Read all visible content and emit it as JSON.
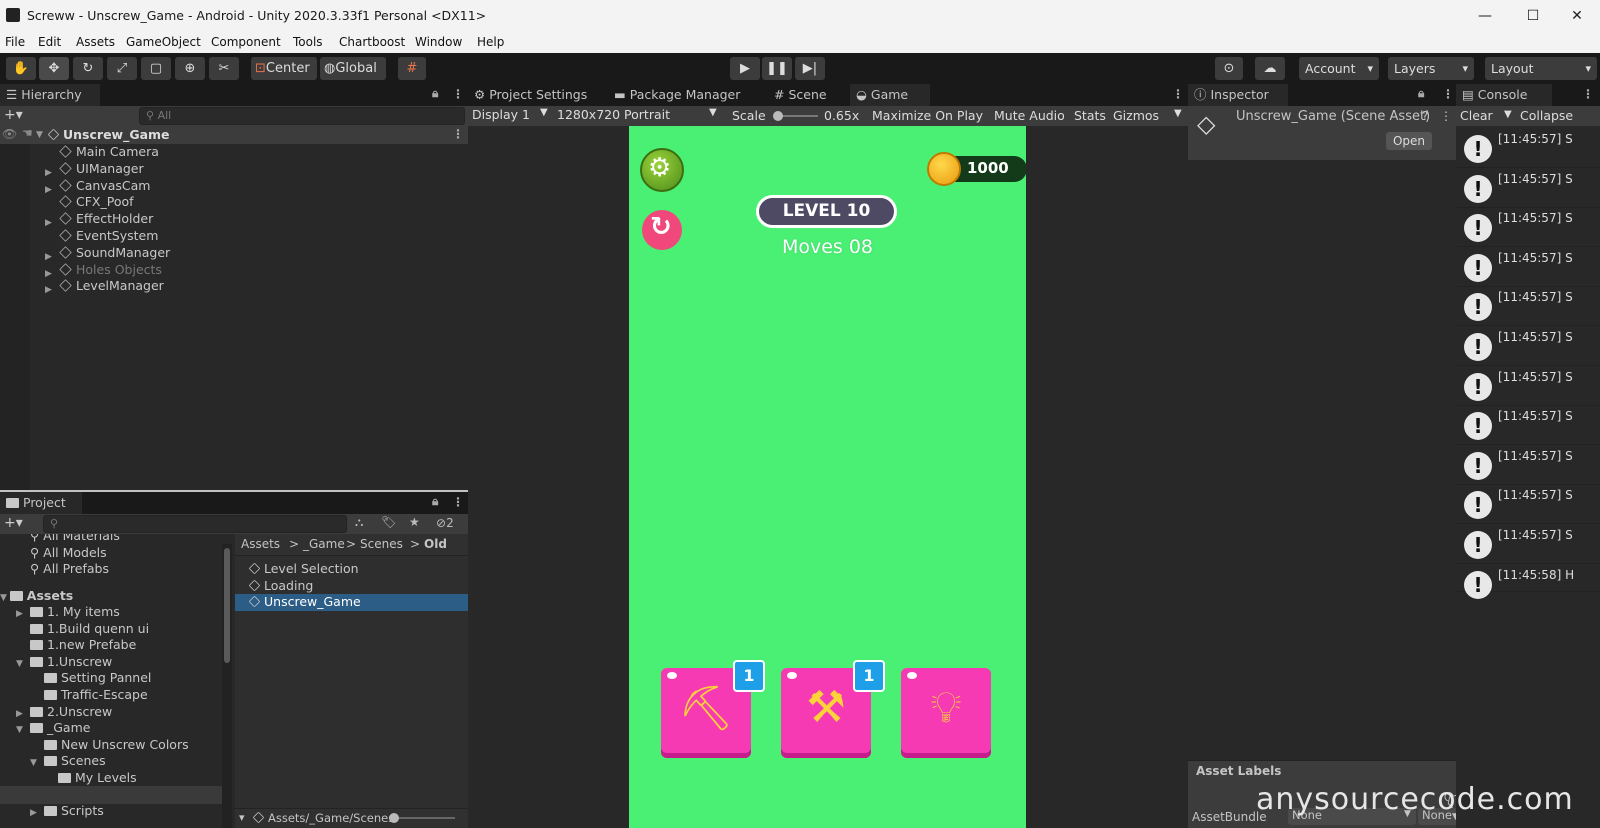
{
  "window": {
    "title": "Screww - Unscrew_Game - Android - Unity 2020.3.33f1 Personal <DX11>",
    "minimize": "—",
    "maximize": "☐",
    "close": "✕"
  },
  "menu": [
    "File",
    "Edit",
    "Assets",
    "GameObject",
    "Component",
    "Tools",
    "Chartboost",
    "Window",
    "Help"
  ],
  "toolbar": {
    "tool_icons": [
      "hand-icon",
      "move-icon",
      "rotate-icon",
      "scale-icon",
      "rect-icon",
      "transform-icon",
      "custom-tool-icon"
    ],
    "pivot": "Center",
    "space": "Global",
    "account": "Account",
    "layers": "Layers",
    "layout": "Layout"
  },
  "hierarchy": {
    "tab": "Hierarchy",
    "search_placeholder": "All",
    "scene": "Unscrew_Game",
    "items": [
      {
        "label": "Main Camera",
        "expandable": false,
        "dim": false
      },
      {
        "label": "UIManager",
        "expandable": true,
        "dim": false
      },
      {
        "label": "CanvasCam",
        "expandable": true,
        "dim": false
      },
      {
        "label": "CFX_Poof",
        "expandable": false,
        "dim": false
      },
      {
        "label": "EffectHolder",
        "expandable": true,
        "dim": false
      },
      {
        "label": "EventSystem",
        "expandable": false,
        "dim": false
      },
      {
        "label": "SoundManager",
        "expandable": true,
        "dim": false
      },
      {
        "label": "Holes Objects",
        "expandable": true,
        "dim": true
      },
      {
        "label": "LevelManager",
        "expandable": true,
        "dim": false
      }
    ]
  },
  "project": {
    "tab": "Project",
    "hidden_count": "2",
    "favorites": [
      "All Materials",
      "All Models",
      "All Prefabs"
    ],
    "assets_label": "Assets",
    "tree": [
      {
        "label": "1. My items",
        "depth": 1,
        "arrow": "▶"
      },
      {
        "label": "1.Build quenn ui",
        "depth": 1,
        "arrow": ""
      },
      {
        "label": "1.new Prefabe",
        "depth": 1,
        "arrow": ""
      },
      {
        "label": "1.Unscrew",
        "depth": 1,
        "arrow": "▼"
      },
      {
        "label": "Setting Pannel",
        "depth": 2,
        "arrow": ""
      },
      {
        "label": "Traffic-Escape",
        "depth": 2,
        "arrow": ""
      },
      {
        "label": "2.Unscrew",
        "depth": 1,
        "arrow": "▶"
      },
      {
        "label": "_Game",
        "depth": 1,
        "arrow": "▼"
      },
      {
        "label": "New Unscrew Colors",
        "depth": 2,
        "arrow": ""
      },
      {
        "label": "Scenes",
        "depth": 2,
        "arrow": "▼"
      },
      {
        "label": "My Levels",
        "depth": 3,
        "arrow": ""
      },
      {
        "label": "Old",
        "depth": 3,
        "arrow": ""
      },
      {
        "label": "Scripts",
        "depth": 2,
        "arrow": "▶"
      }
    ],
    "breadcrumb": [
      "Assets",
      "_Game",
      "Scenes",
      "Old"
    ],
    "files": [
      "Level Selection",
      "Loading",
      "Unscrew_Game"
    ],
    "footer_path": "Assets/_Game/Scenes"
  },
  "tabs": {
    "project_settings": "Project Settings",
    "package_manager": "Package Manager",
    "scene": "Scene",
    "game": "Game"
  },
  "game_toolbar": {
    "display": "Display 1",
    "resolution": "1280x720 Portrait",
    "scale_label": "Scale",
    "scale_value": "0.65x",
    "scale_fraction": 0.1,
    "maximize": "Maximize On Play",
    "mute": "Mute Audio",
    "stats": "Stats",
    "gizmos": "Gizmos"
  },
  "game": {
    "coins": "1000",
    "level": "LEVEL 10",
    "moves": "Moves 08",
    "powerups": [
      {
        "icon": "drill-icon",
        "badge": "1"
      },
      {
        "icon": "hammer-icon",
        "badge": "1"
      },
      {
        "icon": "lightbulb-icon",
        "badge": ""
      }
    ],
    "colors": {
      "bg": "#4af074",
      "pink": "#f53ab4",
      "badge": "#1e9fe8"
    }
  },
  "inspector": {
    "tab": "Inspector",
    "title": "Unscrew_Game (Scene Asset)",
    "open": "Open",
    "labels": "Asset Labels",
    "assetbundle": "AssetBundle",
    "bundle_value": "None",
    "variant_value": "None"
  },
  "console": {
    "tab": "Console",
    "clear": "Clear",
    "collapse": "Collapse",
    "entries": [
      "[11:45:57] S",
      "[11:45:57] S",
      "[11:45:57] S",
      "[11:45:57] S",
      "[11:45:57] S",
      "[11:45:57] S",
      "[11:45:57] S",
      "[11:45:57] S",
      "[11:45:57] S",
      "[11:45:57] S",
      "[11:45:57] S",
      "[11:45:58] H"
    ]
  },
  "watermark": "anysourcecode.com"
}
